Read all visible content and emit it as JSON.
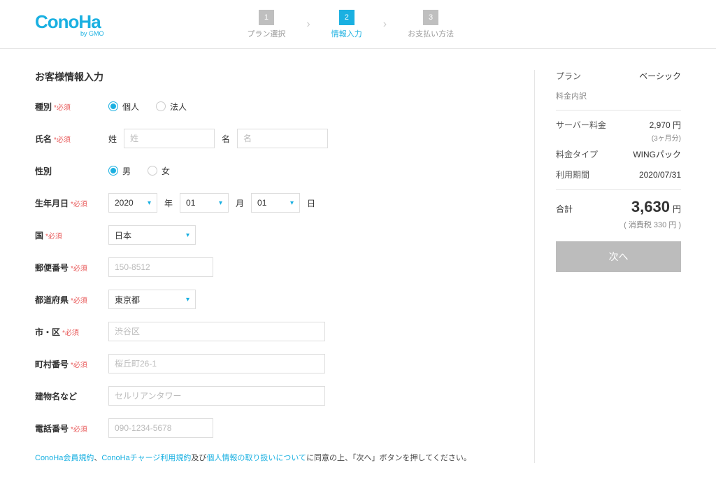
{
  "logo": {
    "text": "ConoHa",
    "sub": "by GMO"
  },
  "steps": [
    {
      "num": "1",
      "label": "プラン選択"
    },
    {
      "num": "2",
      "label": "情報入力"
    },
    {
      "num": "3",
      "label": "お支払い方法"
    }
  ],
  "form": {
    "title": "お客様情報入力",
    "required_mark": "*必須",
    "labels": {
      "type": "種別",
      "name": "氏名",
      "gender": "性別",
      "birth": "生年月日",
      "country": "国",
      "postal": "郵便番号",
      "pref": "都道府県",
      "city": "市・区",
      "town": "町村番号",
      "building": "建物名など",
      "phone": "電話番号"
    },
    "type_options": {
      "individual": "個人",
      "corporate": "法人"
    },
    "name_parts": {
      "sei_label": "姓",
      "mei_label": "名",
      "sei_ph": "姓",
      "mei_ph": "名"
    },
    "gender_options": {
      "male": "男",
      "female": "女"
    },
    "birth_vals": {
      "year": "2020",
      "month": "01",
      "day": "01",
      "year_suffix": "年",
      "month_suffix": "月",
      "day_suffix": "日"
    },
    "country": "日本",
    "postal_ph": "150-8512",
    "pref": "東京都",
    "city_ph": "渋谷区",
    "town_ph": "桜丘町26-1",
    "building_ph": "セルリアンタワー",
    "phone_ph": "090-1234-5678"
  },
  "agree": {
    "link1": "ConoHa会員規約",
    "sep1": "、",
    "link2": "ConoHaチャージ利用規約",
    "mid": "及び",
    "link3": "個人情報の取り扱いについて",
    "tail": "に同意の上、「次へ」ボタンを押してください。"
  },
  "sidebar": {
    "plan_label": "プラン",
    "plan_value": "ベーシック",
    "breakdown_title": "料金内訳",
    "server_fee_label": "サーバー料金",
    "server_fee_value": "2,970 円",
    "server_fee_sub": "(3ヶ月分)",
    "fee_type_label": "料金タイプ",
    "fee_type_value": "WINGパック",
    "period_label": "利用期間",
    "period_value": "2020/07/31",
    "total_label": "合計",
    "total_amount": "3,630",
    "total_unit": "円",
    "tax": "( 消費税 330 円 )",
    "next_button": "次へ"
  }
}
